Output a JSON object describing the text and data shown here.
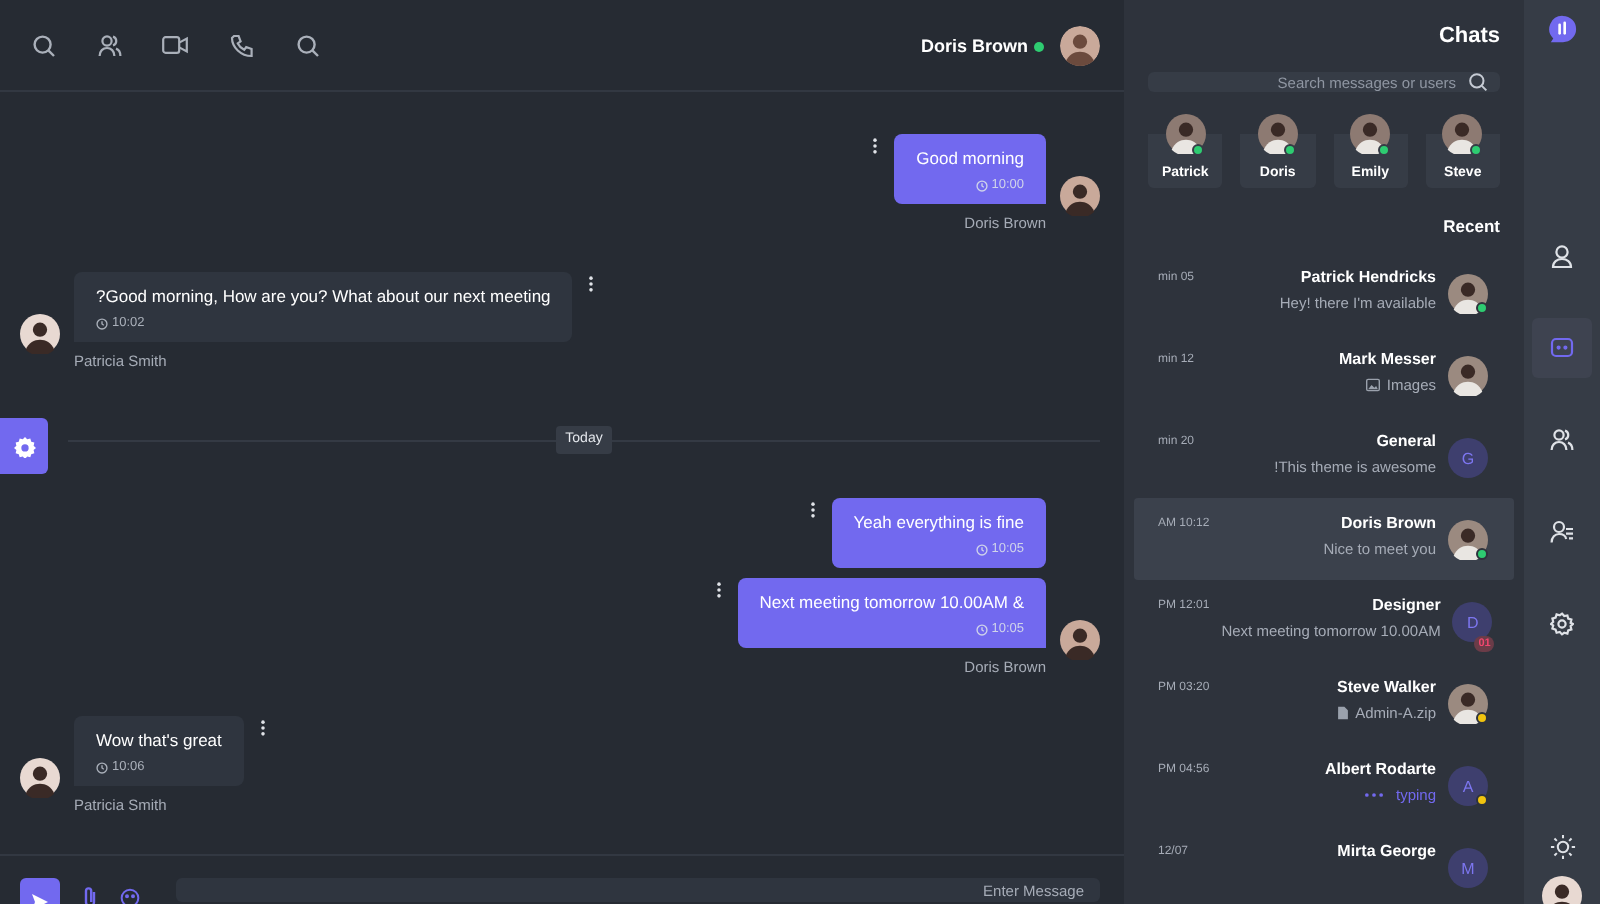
{
  "header": {
    "name": "Doris Brown",
    "online": true,
    "icons": [
      {
        "kind": "search"
      },
      {
        "kind": "users"
      },
      {
        "kind": "video"
      },
      {
        "kind": "phone"
      },
      {
        "kind": "search"
      }
    ]
  },
  "thread": [
    {
      "kind": "group",
      "outgoing": true,
      "sender": "Doris Brown",
      "messages": [
        {
          "text": "Good morning",
          "time": "10:00"
        }
      ]
    },
    {
      "kind": "group",
      "outgoing": false,
      "sender": "Patricia Smith",
      "messages": [
        {
          "text": "?Good morning, How are you? What about our next meeting",
          "time": "10:02"
        }
      ]
    },
    {
      "kind": "divider",
      "label": "Today"
    },
    {
      "kind": "group",
      "outgoing": true,
      "sender": "Doris Brown",
      "messages": [
        {
          "text": "Yeah everything is fine",
          "time": "10:05"
        },
        {
          "text": "Next meeting tomorrow 10.00AM &",
          "time": "10:05"
        }
      ]
    },
    {
      "kind": "group",
      "outgoing": false,
      "sender": "Patricia Smith",
      "messages": [
        {
          "text": "Wow that's great",
          "time": "10:06"
        }
      ]
    }
  ],
  "composer": {
    "placeholder": "Enter Message"
  },
  "chats": {
    "title": "Chats",
    "search": {
      "placeholder": "Search messages or users"
    },
    "online": [
      {
        "name": "Patrick",
        "color": "#2ecc71"
      },
      {
        "name": "Doris",
        "color": "#2ecc71"
      },
      {
        "name": "Emily",
        "color": "#2ecc71"
      },
      {
        "name": "Steve",
        "color": "#2ecc71"
      }
    ],
    "recent_title": "Recent",
    "items": [
      {
        "name": "Patrick Hendricks",
        "preview": {
          "kind": "text",
          "text": "Hey! there I'm available"
        },
        "time": "min 05",
        "avatar": {
          "kind": "photo"
        },
        "color": "#2ecc71",
        "selected": false
      },
      {
        "name": "Mark Messer",
        "preview": {
          "kind": "image",
          "text": "Images"
        },
        "time": "min 12",
        "avatar": {
          "kind": "photo"
        },
        "selected": false
      },
      {
        "name": "General",
        "preview": {
          "kind": "text",
          "text": "!This theme is awesome"
        },
        "time": "min 20",
        "avatar": {
          "kind": "letter",
          "letter": "G"
        },
        "selected": false
      },
      {
        "name": "Doris Brown",
        "preview": {
          "kind": "text",
          "text": "Nice to meet you"
        },
        "time": "AM 10:12",
        "avatar": {
          "kind": "photo"
        },
        "color": "#2ecc71",
        "selected": true
      },
      {
        "name": "Designer",
        "preview": {
          "kind": "text",
          "text": "Next meeting tomorrow 10.00AM"
        },
        "time": "PM 12:01",
        "avatar": {
          "kind": "letter",
          "letter": "D"
        },
        "badge": "01",
        "selected": false
      },
      {
        "name": "Steve Walker",
        "preview": {
          "kind": "file",
          "text": "Admin-A.zip"
        },
        "time": "PM 03:20",
        "avatar": {
          "kind": "photo"
        },
        "color": "#f1c40f",
        "selected": false
      },
      {
        "name": "Albert Rodarte",
        "preview": {
          "kind": "typing",
          "text": "typing"
        },
        "time": "PM 04:56",
        "avatar": {
          "kind": "letter",
          "letter": "A"
        },
        "color": "#f1c40f",
        "selected": false
      },
      {
        "name": "Mirta George",
        "time": "12/07",
        "avatar": {
          "kind": "letter",
          "letter": "M"
        },
        "selected": false
      }
    ]
  },
  "nav": [
    {
      "kind": "profile",
      "selected": false
    },
    {
      "kind": "chats",
      "selected": true
    },
    {
      "kind": "groups",
      "selected": false
    },
    {
      "kind": "contacts",
      "selected": false
    },
    {
      "kind": "settings",
      "selected": false
    }
  ]
}
